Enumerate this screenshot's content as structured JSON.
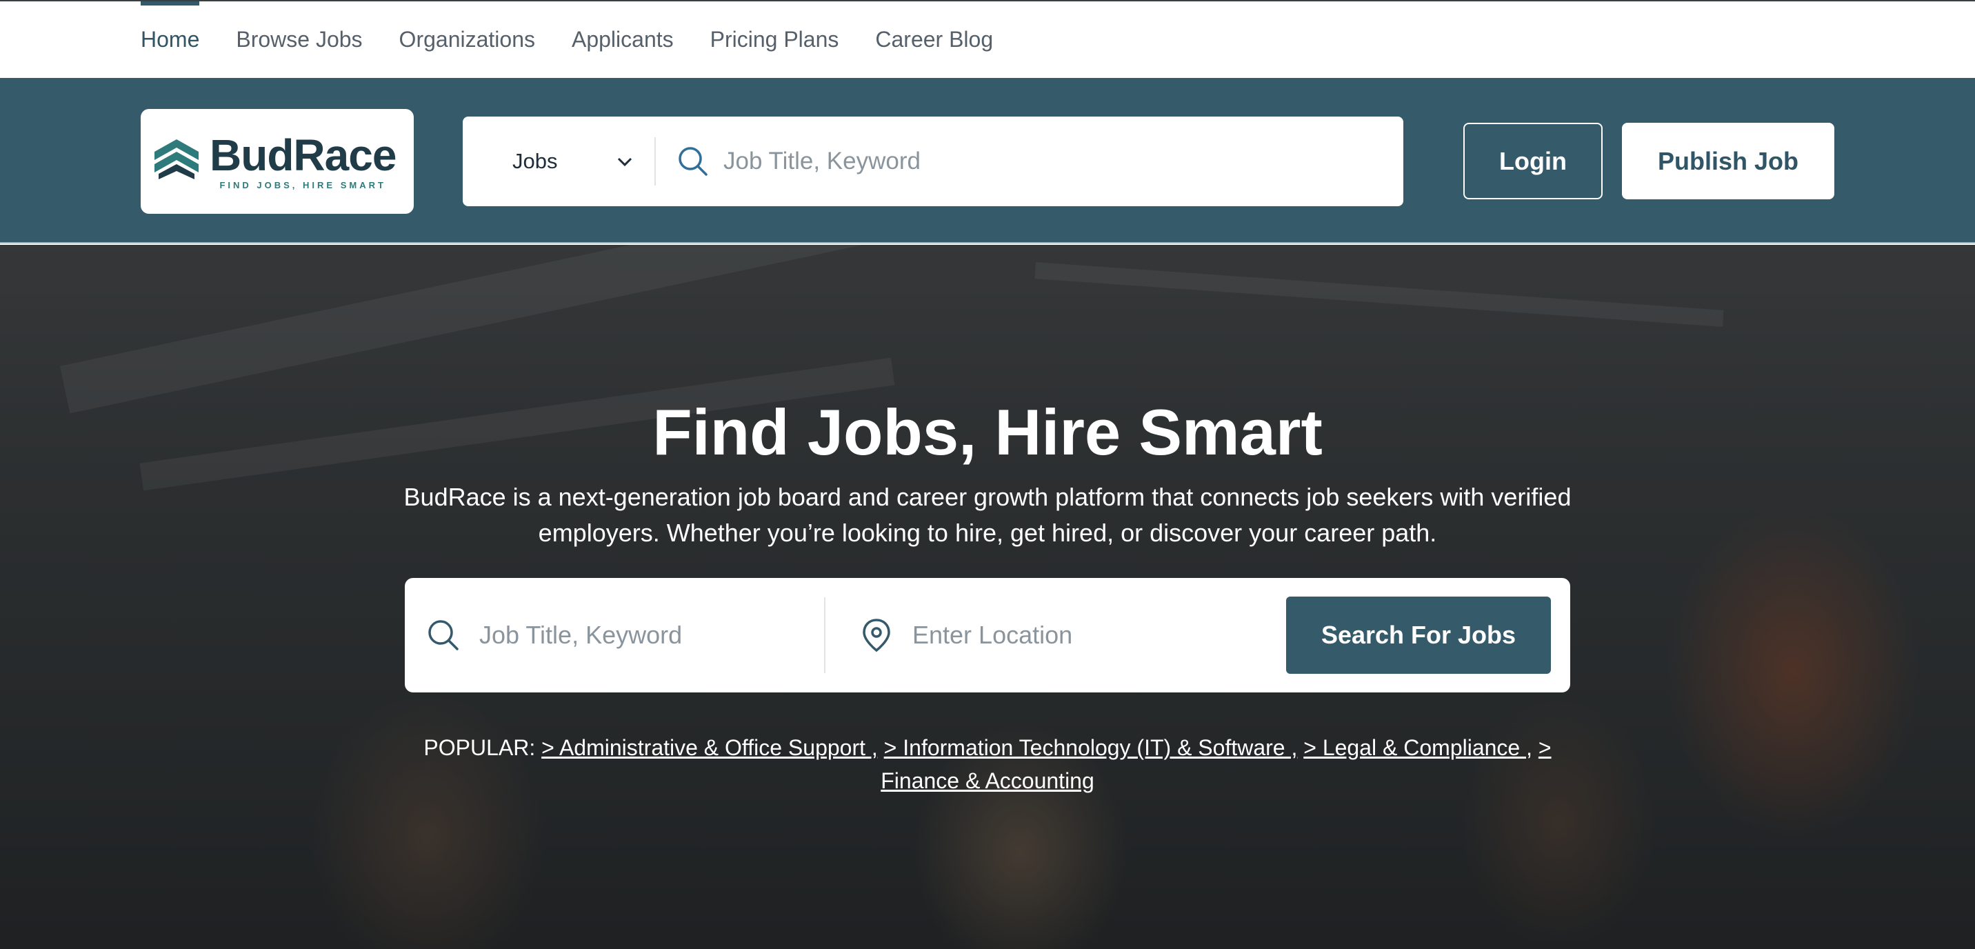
{
  "nav": {
    "items": [
      {
        "label": "Home",
        "active": true
      },
      {
        "label": "Browse Jobs",
        "active": false
      },
      {
        "label": "Organizations",
        "active": false
      },
      {
        "label": "Applicants",
        "active": false
      },
      {
        "label": "Pricing Plans",
        "active": false
      },
      {
        "label": "Career Blog",
        "active": false
      }
    ]
  },
  "header": {
    "logo": {
      "name": "BudRace",
      "tagline": "FIND JOBS, HIRE SMART"
    },
    "search": {
      "category": "Jobs",
      "placeholder": "Job Title, Keyword"
    },
    "login_label": "Login",
    "publish_label": "Publish Job"
  },
  "hero": {
    "title_part1": "Find",
    "title_part2": "Jobs,",
    "title_part3": "Hire",
    "title_part4": "Smart",
    "subtitle": "BudRace is a next-generation job board and career growth platform that connects job seekers with verified employers. Whether you’re looking to hire, get hired, or discover your career path.",
    "search": {
      "keyword_placeholder": "Job Title, Keyword",
      "location_placeholder": "Enter Location",
      "button_label": "Search For Jobs"
    },
    "popular": {
      "label": "POPULAR:",
      "links": [
        "> Administrative & Office Support ,",
        "> Information Technology (IT) & Software ,",
        "> Legal & Compliance ,",
        "> Finance & Accounting"
      ]
    }
  },
  "colors": {
    "brand": "#355b6b",
    "logo_text": "#1f3c48",
    "logo_accent": "#2f7a7a"
  }
}
